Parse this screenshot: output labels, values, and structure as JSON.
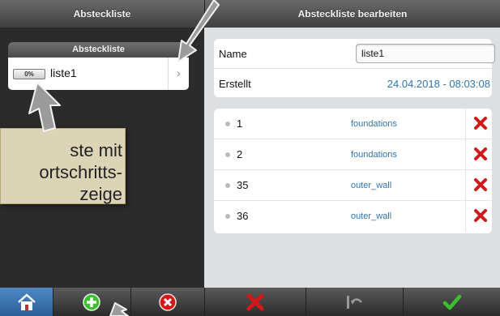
{
  "left_panel": {
    "title": "Absteckliste",
    "list_header": "Absteckliste",
    "row": {
      "progress": "0%",
      "label": "liste1",
      "chevron": "›"
    }
  },
  "right_panel": {
    "title": "Absteckliste bearbeiten",
    "form": {
      "name_label": "Name",
      "name_value": "liste1",
      "created_label": "Erstellt",
      "created_value": "24.04.2018 - 08:03:08"
    },
    "items": [
      {
        "number": "1",
        "tag": "foundations"
      },
      {
        "number": "2",
        "tag": "foundations"
      },
      {
        "number": "35",
        "tag": "outer_wall"
      },
      {
        "number": "36",
        "tag": "outer_wall"
      }
    ]
  },
  "callout": {
    "text": "ste mit\nortschritts-\nzeige"
  },
  "toolbar_left": [
    "home-icon",
    "add-icon",
    "remove-icon"
  ],
  "toolbar_right": [
    "delete-icon",
    "undo-icon",
    "confirm-icon"
  ],
  "colors": {
    "accent_blue": "#2f74b0",
    "delete_red": "#d21818",
    "confirm_green": "#3cbf2f",
    "active_tab": "#3b78b8"
  }
}
